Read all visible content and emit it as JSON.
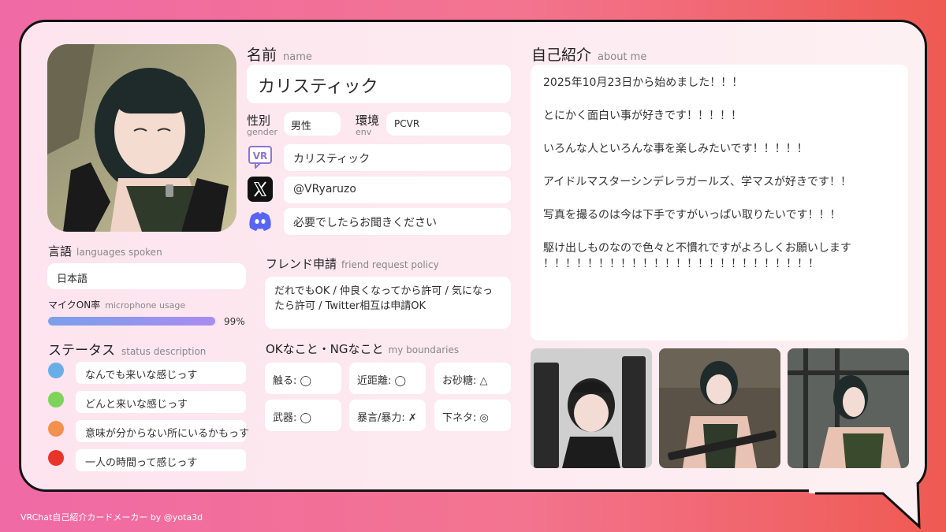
{
  "name": {
    "label_jp": "名前",
    "label_en": "name",
    "value": "カリスティック"
  },
  "gender": {
    "label_jp": "性別",
    "label_en": "gender",
    "value": "男性"
  },
  "env": {
    "label_jp": "環境",
    "label_en": "env",
    "value": "PCVR"
  },
  "sns": {
    "vrchat": "カリスティック",
    "x": "@VRyaruzo",
    "discord": "必要でしたらお聞きください"
  },
  "languages": {
    "label_jp": "言語",
    "label_en": "languages spoken",
    "value": "日本語"
  },
  "mic": {
    "label_jp": "マイクON率",
    "label_en": "microphone usage",
    "value": "99%",
    "percent": 99
  },
  "status": {
    "label_jp": "ステータス",
    "label_en": "status description",
    "items": [
      {
        "color": "#6aaee8",
        "text": "なんでも来いな感じっす"
      },
      {
        "color": "#7ed35a",
        "text": "どんと来いな感じっす"
      },
      {
        "color": "#f3914f",
        "text": "意味が分からない所にいるかもっす"
      },
      {
        "color": "#e8342a",
        "text": "一人の時間って感じっす"
      }
    ]
  },
  "friend": {
    "label_jp": "フレンド申請",
    "label_en": "friend request policy",
    "text": "だれでもOK / 仲良くなってから許可 / 気になったら許可 / Twitter相互は申請OK"
  },
  "boundaries": {
    "label_jp": "OKなこと・NGなこと",
    "label_en": "my boundaries",
    "items": [
      "触る: ◯",
      "近距離: ◯",
      "お砂糖: △",
      "武器: ◯",
      "暴言/暴力: ✗",
      "下ネタ: ◎"
    ]
  },
  "about": {
    "label_jp": "自己紹介",
    "label_en": "about me",
    "lines": [
      "2025年10月23日から始めました！！！",
      "とにかく面白い事が好きです！！！！！",
      "いろんな人といろんな事を楽しみたいです！！！！！",
      "アイドルマスターシンデレラガールズ、学マスが好きです！！",
      "写真を撮るのは今は下手ですがいっぱい取りたいです！！！",
      "駆け出しものなので色々と不慣れですがよろしくお願いします",
      "！！！！！！！！！！！！！！！！！！！！！！！！！"
    ]
  },
  "footer": "VRChat自己紹介カードメーカー by @yota3d",
  "icons": {
    "vrchat": "vrchat-icon",
    "x": "x-logo-icon",
    "discord": "discord-icon"
  }
}
